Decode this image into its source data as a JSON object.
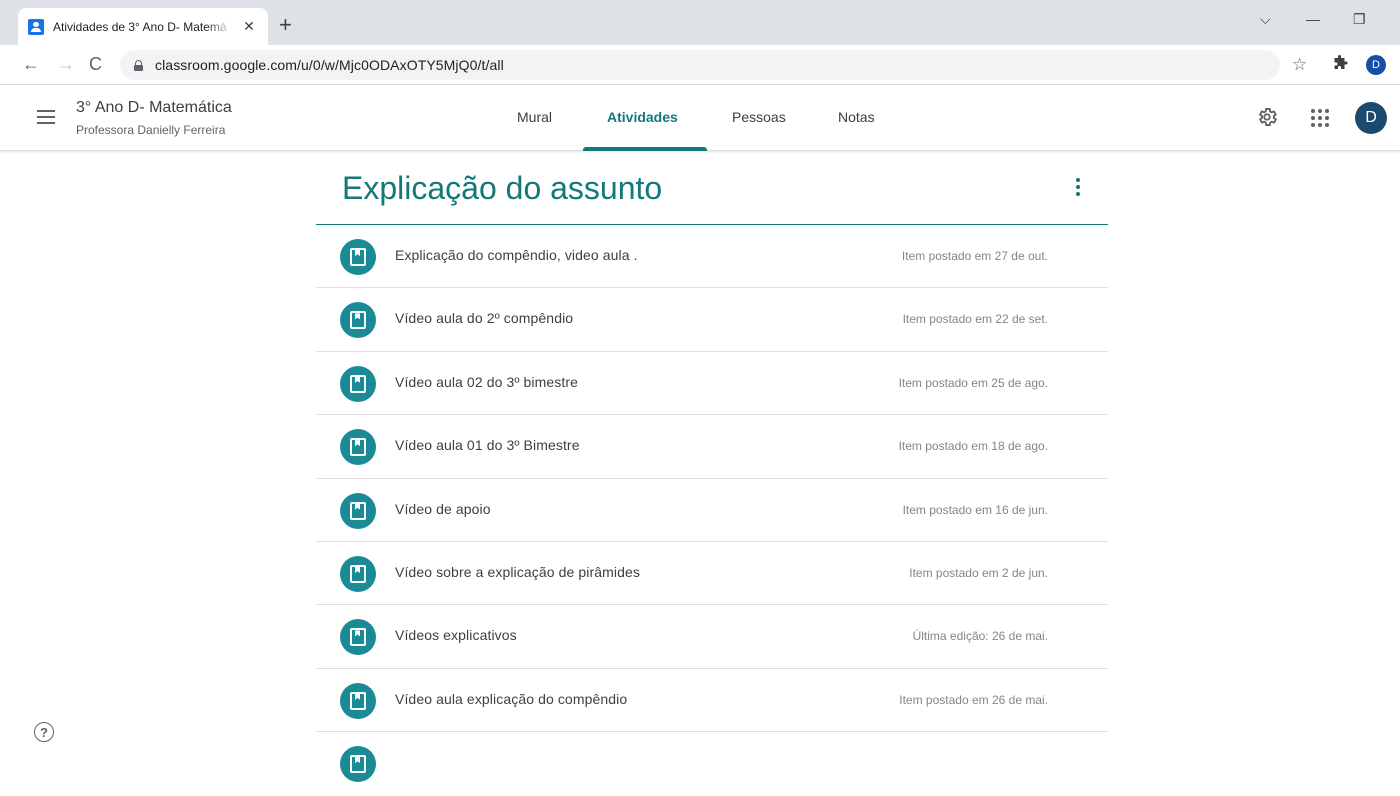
{
  "browser": {
    "tab_title": "Atividades de 3° Ano D- Matemá",
    "tab_close": "✕",
    "new_tab": "+",
    "url": "classroom.google.com/u/0/w/Mjc0ODAxOTY5MjQ0/t/all",
    "profile_initial": "D",
    "window_controls": {
      "dropdown": "⌵",
      "minimize": "—",
      "restore": "❐"
    }
  },
  "header": {
    "class_title": "3° Ano D- Matemática",
    "class_subtitle": "Professora Danielly Ferreira",
    "tabs": [
      {
        "label": "Mural",
        "active": false
      },
      {
        "label": "Atividades",
        "active": true
      },
      {
        "label": "Pessoas",
        "active": false
      },
      {
        "label": "Notas",
        "active": false
      }
    ],
    "avatar_initial": "D"
  },
  "topic": {
    "title": "Explicação do assunto"
  },
  "materials": [
    {
      "title": "Explicação do compêndio, video aula .",
      "date": "Item postado em 27 de out."
    },
    {
      "title": "Vídeo aula do 2º compêndio",
      "date": "Item postado em 22 de set."
    },
    {
      "title": "Vídeo aula 02 do 3º bimestre",
      "date": "Item postado em 25 de ago."
    },
    {
      "title": "Vídeo aula 01 do 3º Bimestre",
      "date": "Item postado em 18 de ago."
    },
    {
      "title": "Vídeo de apoio",
      "date": "Item postado em 16 de jun."
    },
    {
      "title": "Vídeo sobre a explicação de pirâmides",
      "date": "Item postado em 2 de jun."
    },
    {
      "title": "Vídeos explicativos",
      "date": "Última edição: 26 de mai."
    },
    {
      "title": "Vídeo aula explicação do compêndio",
      "date": "Item postado em 26 de mai."
    }
  ],
  "help": {
    "label": "?"
  },
  "colors": {
    "accent": "#137878",
    "material_icon": "#1b8a97"
  }
}
